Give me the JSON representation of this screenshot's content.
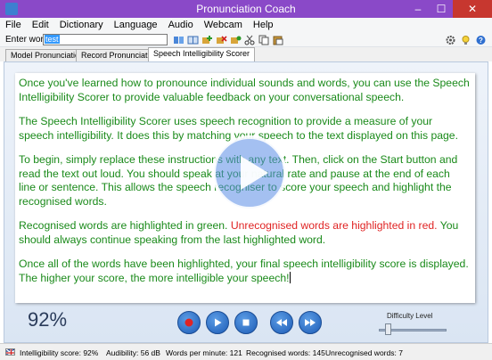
{
  "window": {
    "title": "Pronunciation Coach",
    "controls": {
      "minimize": "–",
      "maximize": "☐",
      "close": "✕"
    }
  },
  "menu": [
    "File",
    "Edit",
    "Dictionary",
    "Language",
    "Audio",
    "Webcam",
    "Help"
  ],
  "toolbar": {
    "enter_word_label": "Enter word:",
    "word_value": "test",
    "icons": [
      "book-icon",
      "dictionary-icon",
      "add-word-icon",
      "delete-word-icon",
      "edit-word-icon",
      "cut-icon",
      "copy-icon",
      "paste-icon"
    ],
    "right_icons": [
      "settings-icon",
      "tip-icon",
      "help-icon"
    ]
  },
  "tabs": {
    "items": [
      "Model Pronunciation",
      "Record Pronunciation",
      "Speech Intelligibility Scorer"
    ],
    "active": "Speech Intelligibility Scorer"
  },
  "document": {
    "p1": "Once you've learned how to pronounce individual sounds and words, you can use the Speech Intelligibility Scorer to provide valuable feedback on your conversational speech.",
    "p2": "The Speech Intelligibility Scorer uses speech recognition to provide a measure of your speech intelligibility. It does this by matching your speech to the text displayed on this page.",
    "p3": "To begin, simply replace these instructions with any text. Then, click on the Start button and read the text out loud. You should speak at your natural rate and pause at the end of each line or sentence. This allows the speech recogniser to score your speech and highlight the recognised words.",
    "p4_green": "Recognised words are highlighted in green.",
    "p4_red": "Unrecognised words are highlighted in red.",
    "p4_green2": "You should always continue speaking from the last highlighted word.",
    "p5": "Once all of the words have been highlighted, your final speech intelligibility score is displayed. The higher your score, the more intelligible your speech!",
    "recognised_color": "#1a8a1a",
    "unrecognised_color": "#e02424"
  },
  "controls": {
    "score": "92%",
    "buttons": [
      "record-button",
      "play-button",
      "stop-button",
      "rewind-button",
      "fast-forward-button"
    ],
    "difficulty_label": "Difficulty Level",
    "difficulty_level": 0.1
  },
  "status": {
    "intelligibility": "Intelligibility score: 92%",
    "audibility": "Audibility: 56 dB",
    "wpm": "Words per minute: 121",
    "recognised": "Recognised words: 145",
    "unrecognised": "Unrecognised words: 7"
  }
}
